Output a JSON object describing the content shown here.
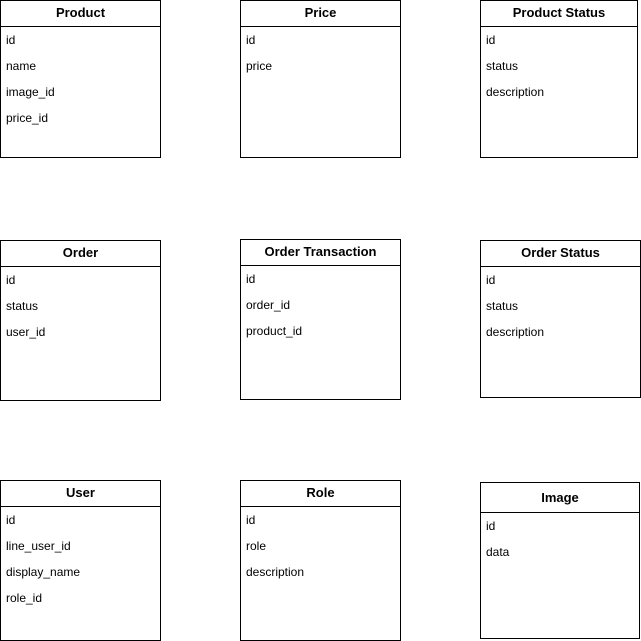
{
  "entities": {
    "product": {
      "name": "Product",
      "fields": [
        "id",
        "name",
        "image_id",
        "price_id"
      ]
    },
    "price": {
      "name": "Price",
      "fields": [
        "id",
        "price"
      ]
    },
    "product_status": {
      "name": "Product Status",
      "fields": [
        "id",
        "status",
        "description"
      ]
    },
    "order": {
      "name": "Order",
      "fields": [
        "id",
        "status",
        "user_id"
      ]
    },
    "order_transaction": {
      "name": "Order Transaction",
      "fields": [
        "id",
        "order_id",
        "product_id"
      ]
    },
    "order_status": {
      "name": "Order Status",
      "fields": [
        "id",
        "status",
        "description"
      ]
    },
    "user": {
      "name": "User",
      "fields": [
        "id",
        "line_user_id",
        "display_name",
        "role_id"
      ]
    },
    "role": {
      "name": "Role",
      "fields": [
        "id",
        "role",
        "description"
      ]
    },
    "image": {
      "name": "Image",
      "fields": [
        "id",
        "data"
      ]
    }
  }
}
